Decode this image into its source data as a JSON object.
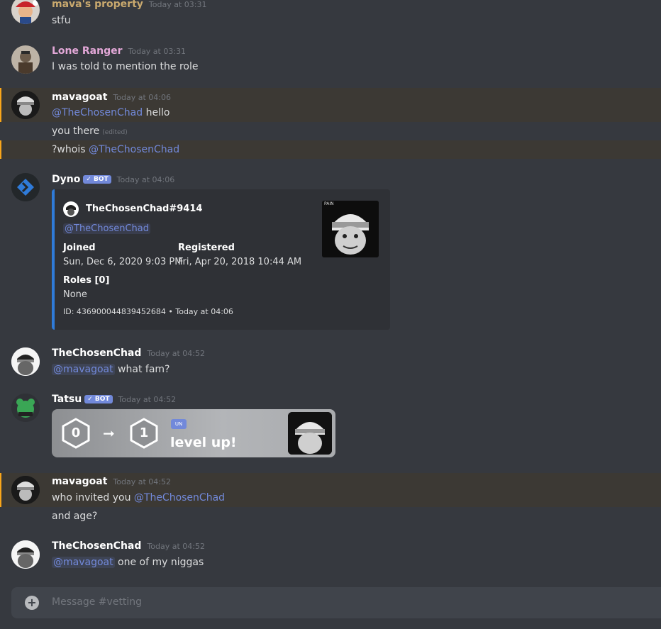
{
  "channel": {
    "placeholder": "Message #vetting"
  },
  "messages": {
    "m1": {
      "user": "mava's property",
      "time": "Today at 03:31",
      "text": "stfu",
      "color": "#c9a96e"
    },
    "m2": {
      "user": "Lone Ranger",
      "time": "Today at 03:31",
      "text": "I was told to mention the role",
      "color": "#e3a8d8"
    },
    "m3": {
      "user": "mavagoat",
      "time": "Today at 04:06",
      "mention": "@TheChosenChad",
      "text": " hello",
      "line2": "you there",
      "edited": "(edited)",
      "line3_pre": "?whois ",
      "line3_mention": "@TheChosenChad",
      "color": "#ffffff"
    },
    "m4": {
      "user": "Dyno",
      "badge": "✓ BOT",
      "time": "Today at 04:06",
      "color": "#ffffff"
    },
    "m5": {
      "user": "TheChosenChad",
      "time": "Today at 04:52",
      "mention": "@mavagoat",
      "text": " what fam?",
      "color": "#ffffff"
    },
    "m6": {
      "user": "Tatsu",
      "badge": "✓ BOT",
      "time": "Today at 04:52",
      "color": "#ffffff"
    },
    "m7": {
      "user": "mavagoat",
      "time": "Today at 04:52",
      "text_pre": "who invited you ",
      "mention": "@TheChosenChad",
      "line2": "and age?",
      "color": "#ffffff"
    },
    "m8": {
      "user": "TheChosenChad",
      "time": "Today at 04:52",
      "mention": "@mavagoat",
      "text": " one of my niggas",
      "color": "#ffffff"
    }
  },
  "embed": {
    "author": "TheChosenChad#9414",
    "mention": "@TheChosenChad",
    "joined_label": "Joined",
    "joined_value": "Sun, Dec 6, 2020 9:03 PM",
    "registered_label": "Registered",
    "registered_value": "Fri, Apr 20, 2018 10:44 AM",
    "roles_label": "Roles [0]",
    "roles_value": "None",
    "footer": "ID: 436900044839452684 • Today at 04:06",
    "thumb_caption": "PAIN",
    "accent": "#2f7bd9"
  },
  "levelup": {
    "from": "0",
    "to": "1",
    "text": "level up!",
    "small_badge": "UN"
  }
}
